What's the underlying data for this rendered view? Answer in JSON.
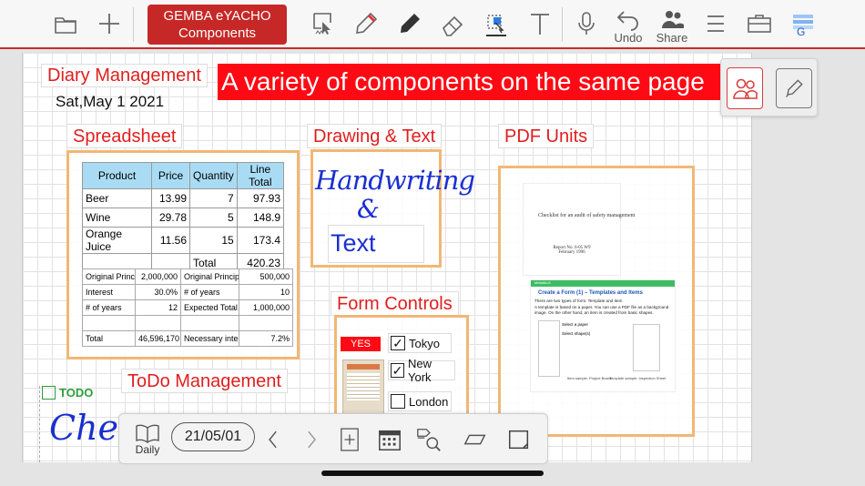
{
  "toolbar": {
    "app_badge_line1": "GEMBA eYACHO",
    "app_badge_line2": "Components",
    "undo_label": "Undo",
    "share_label": "Share",
    "g_badge": "G"
  },
  "page": {
    "diary_title": "Diary Management",
    "date_text": "Sat,May 1 2021",
    "banner_text": "A variety of components on the same page",
    "spreadsheet_title": "Spreadsheet",
    "drawing_title": "Drawing & Text",
    "pdf_title": "PDF Units",
    "form_title": "Form Controls",
    "todo_title": "ToDo Management",
    "todo_label": "TODO",
    "todo_handwriting": "Check"
  },
  "spreadsheet": {
    "headers": [
      "Product",
      "Price",
      "Quantity",
      "Line Total"
    ],
    "rows": [
      [
        "Beer",
        "13.99",
        "7",
        "97.93"
      ],
      [
        "Wine",
        "29.78",
        "5",
        "148.9"
      ],
      [
        "Orange Juice",
        "11.56",
        "15",
        "173.4"
      ],
      [
        "",
        "",
        "Total",
        "420.23"
      ]
    ]
  },
  "calc_sheet": {
    "rows": [
      [
        "Original Principal",
        "2,000,000",
        "Original Principal",
        "500,000"
      ],
      [
        "Interest",
        "30.0%",
        "# of years",
        "10"
      ],
      [
        "# of years",
        "12",
        "Expected Total",
        "1,000,000"
      ],
      [
        "",
        "",
        "",
        ""
      ],
      [
        "Total",
        "46,596,170",
        "Necessary interest",
        "7.2%"
      ]
    ]
  },
  "drawing": {
    "handwriting_line1": "Handwriting",
    "handwriting_line2": "&",
    "text_box": "Text"
  },
  "pdf": {
    "doc_title": "Checklist for an audit of safety management",
    "doc_sub1": "Report No. 6-05 W9",
    "doc_sub2": "February 1996",
    "header_brand": "MetaMoJi",
    "section_title": "Create a Form (1) – Templates and Items",
    "line1": "There are two types of form: Template and Item",
    "line2": "A template is based on a paper. You can use a PDF file as a background image. On the other hand, an item is created from basic shapes.",
    "caption_left": "Item sample: Project Board",
    "caption_right": "Template sample: Inspection Sheet",
    "opt1": "Select a paper",
    "opt2": "Select shape(s)"
  },
  "form": {
    "yes_label": "YES",
    "checks": [
      {
        "label": "Tokyo",
        "checked": true
      },
      {
        "label": "New York",
        "checked": true
      },
      {
        "label": "London",
        "checked": false
      }
    ]
  },
  "bottom_bar": {
    "daily_label": "Daily",
    "date": "21/05/01"
  },
  "colors": {
    "accent_red": "#c62828",
    "banner_red": "#ff0a14",
    "title_red": "#e01e1e",
    "header_blue": "#a9dcf4",
    "box_orange": "#f2b774",
    "ink_blue": "#1a2fd0",
    "todo_green": "#2e9e3a"
  }
}
